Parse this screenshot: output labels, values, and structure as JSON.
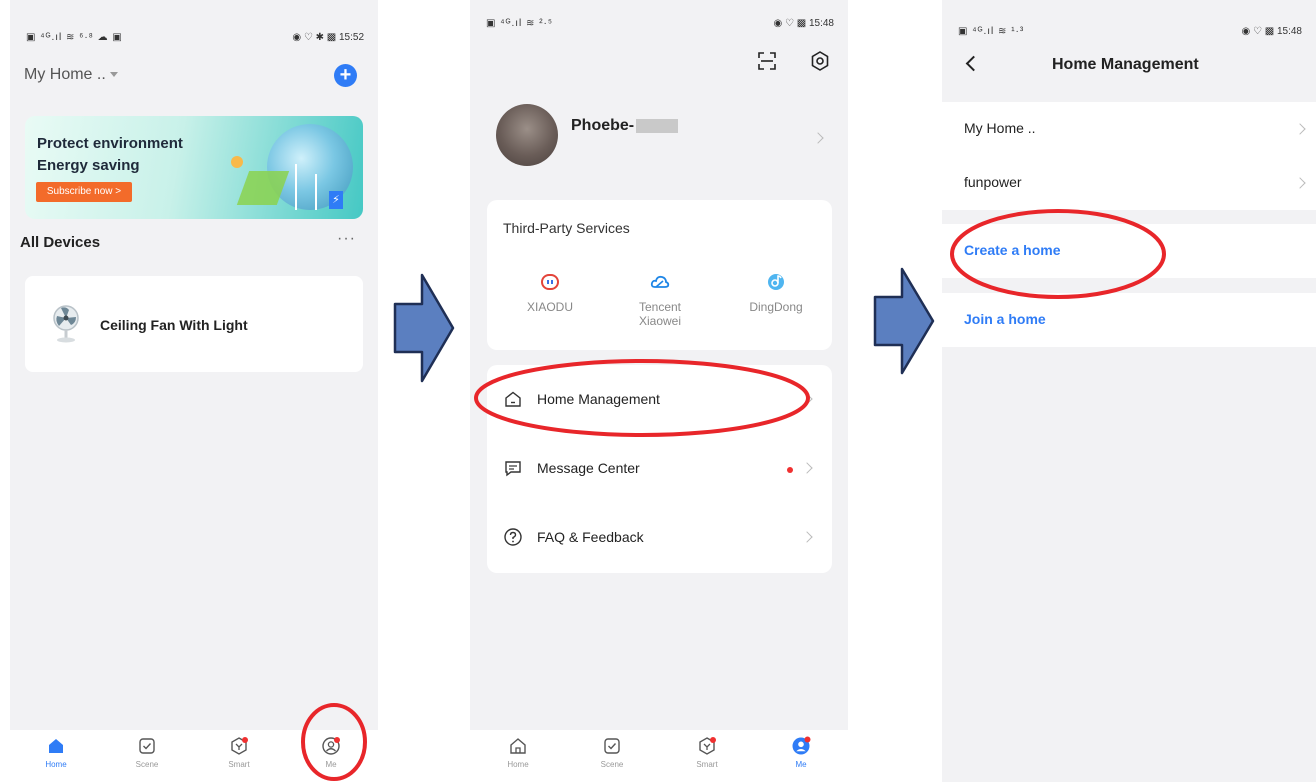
{
  "status": {
    "p1_left": "▣ ⁴ᴳ.ıl ≋ ⁶·⁸ ☁ ▣",
    "p1_right": "◉ ♡ ✱ ▩ 15:52",
    "p2_left": "▣ ⁴ᴳ.ıl ≋ ²·⁵",
    "p2_right": "◉ ♡ ▩ 15:48",
    "p3_left": "▣ ⁴ᴳ.ıl ≋ ¹·³",
    "p3_right": "◉ ♡ ▩ 15:48"
  },
  "screen1": {
    "home_selector": "My Home ..",
    "banner": {
      "line1": "Protect environment",
      "line2": "Energy saving",
      "cta": "Subscribe now >"
    },
    "section_title": "All Devices",
    "more": "···",
    "devices": [
      {
        "name": "Ceiling Fan With Light"
      }
    ],
    "tabs": [
      {
        "label": "Home",
        "icon": "home-icon",
        "active": true
      },
      {
        "label": "Scene",
        "icon": "scene-icon",
        "active": false
      },
      {
        "label": "Smart",
        "icon": "smart-icon",
        "active": false
      },
      {
        "label": "Me",
        "icon": "me-icon",
        "active": false
      }
    ]
  },
  "screen2": {
    "user_name": "Phoebe-",
    "third_party_title": "Third-Party Services",
    "services": [
      {
        "label": "XIAODU",
        "icon": "xiaodu-icon"
      },
      {
        "label": "Tencent Xiaowei",
        "icon": "tencent-cloud-icon"
      },
      {
        "label": "DingDong",
        "icon": "dingdong-icon"
      }
    ],
    "menu": [
      {
        "label": "Home Management",
        "icon": "house-outline-icon"
      },
      {
        "label": "Message Center",
        "icon": "message-icon"
      },
      {
        "label": "FAQ & Feedback",
        "icon": "help-circle-icon"
      }
    ],
    "tabs": [
      {
        "label": "Home",
        "icon": "home-icon",
        "active": false
      },
      {
        "label": "Scene",
        "icon": "scene-icon",
        "active": false
      },
      {
        "label": "Smart",
        "icon": "smart-icon",
        "active": false
      },
      {
        "label": "Me",
        "icon": "me-icon",
        "active": true
      }
    ]
  },
  "screen3": {
    "title": "Home Management",
    "homes": [
      "My Home ..",
      "funpower"
    ],
    "create": "Create a home",
    "join": "Join a home"
  },
  "colors": {
    "accent": "#2f7cf6",
    "annotation": "#e8262a",
    "flow_arrow": "#5b7fc0",
    "cta": "#f36b2a"
  }
}
